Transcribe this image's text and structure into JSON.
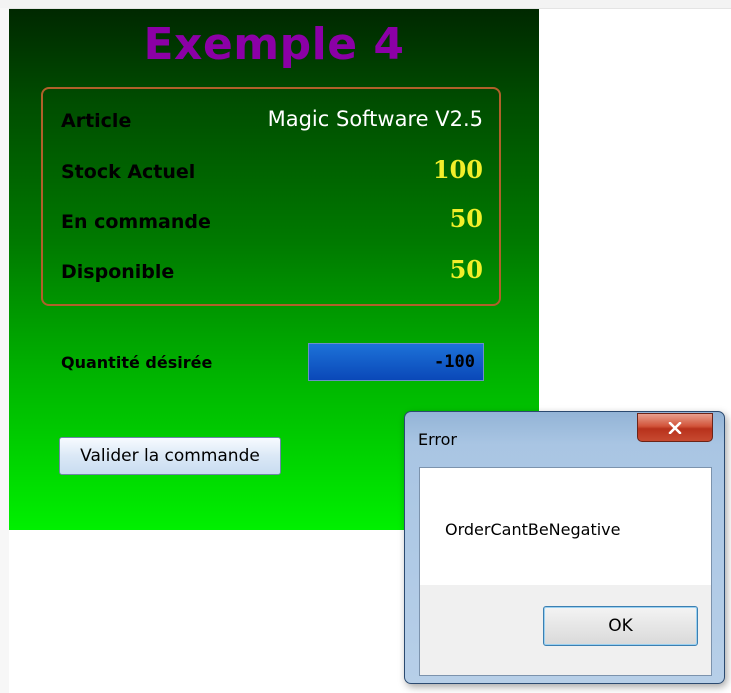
{
  "form": {
    "title": "Exemple 4",
    "article_label": "Article",
    "article_value": "Magic Software V2.5",
    "stock_label": "Stock Actuel",
    "stock_value": "100",
    "order_label": "En commande",
    "order_value": "50",
    "available_label": "Disponible",
    "available_value": "50",
    "quantity_label": "Quantité désirée",
    "quantity_value": "-100",
    "validate_button": "Valider la commande"
  },
  "dialog": {
    "title": "Error",
    "message": "OrderCantBeNegative",
    "ok_button": "OK",
    "close_icon": "close-icon"
  },
  "colors": {
    "title": "#8b00a6",
    "numeric_values": "#f2ef2a",
    "box_border": "#b0602a",
    "close_button": "#c74a31"
  }
}
